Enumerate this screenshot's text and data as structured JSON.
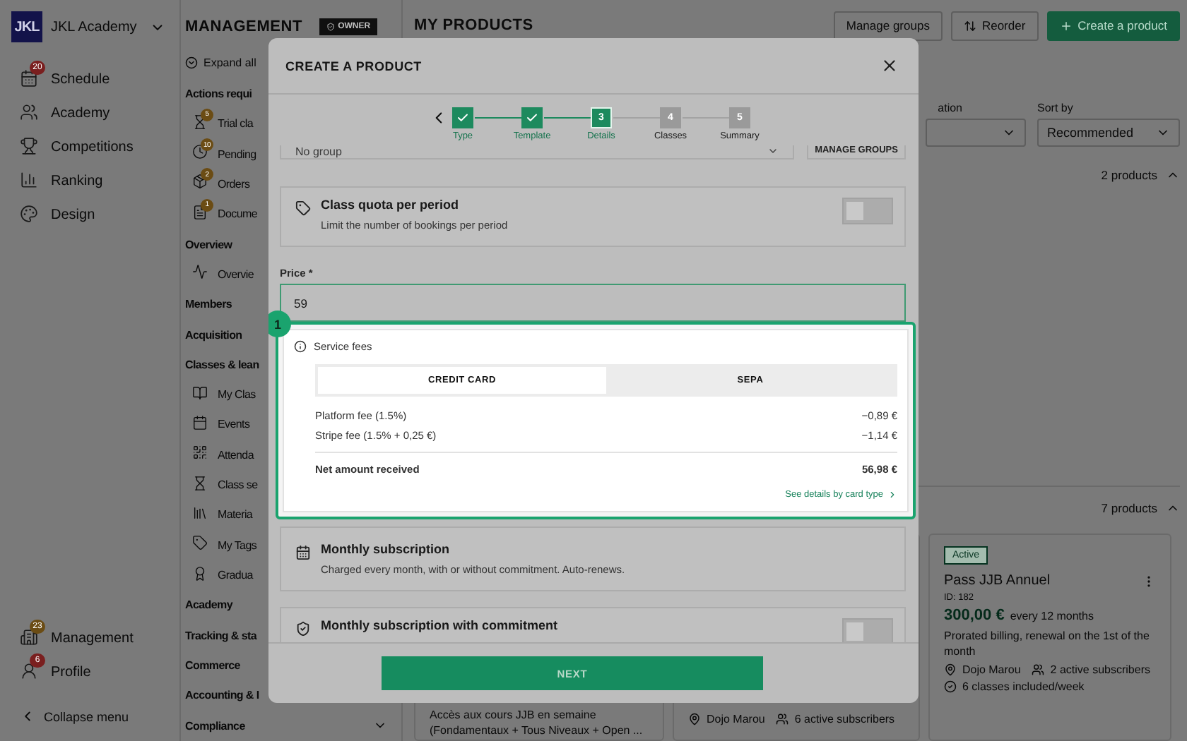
{
  "sidebar": {
    "logo": "JKL",
    "name": "JKL Academy",
    "items": [
      {
        "label": "Schedule",
        "badge": {
          "text": "20",
          "color": "#7a1f1f"
        }
      },
      {
        "label": "Academy"
      },
      {
        "label": "Competitions"
      },
      {
        "label": "Ranking"
      },
      {
        "label": "Design"
      }
    ],
    "bottom_items": [
      {
        "label": "Management",
        "badge": {
          "text": "23",
          "color": "#6b4c14"
        }
      },
      {
        "label": "Profile",
        "badge": {
          "text": "6",
          "color": "#7a1f1f"
        }
      }
    ],
    "collapse": "Collapse menu"
  },
  "management_nav": {
    "title": "MANAGEMENT",
    "role": "OWNER",
    "expand_all": "Expand all",
    "entries": [
      {
        "kind": "section",
        "label": "Actions requi"
      },
      {
        "kind": "item",
        "label": "Trial cla",
        "badge": "5"
      },
      {
        "kind": "item",
        "label": "Pending",
        "badge": "10"
      },
      {
        "kind": "item",
        "label": "Orders",
        "badge": "2"
      },
      {
        "kind": "item",
        "label": "Docume",
        "badge": "1"
      },
      {
        "kind": "section",
        "label": "Overview"
      },
      {
        "kind": "item",
        "label": "Overvie"
      },
      {
        "kind": "section",
        "label": "Members"
      },
      {
        "kind": "section",
        "label": "Acquisition"
      },
      {
        "kind": "section",
        "label": "Classes & lean"
      },
      {
        "kind": "item",
        "label": "My Clas"
      },
      {
        "kind": "item",
        "label": "Events"
      },
      {
        "kind": "item",
        "label": "Attenda"
      },
      {
        "kind": "item",
        "label": "Class se"
      },
      {
        "kind": "item",
        "label": "Materia"
      },
      {
        "kind": "item",
        "label": "My Tags"
      },
      {
        "kind": "item",
        "label": "Gradua"
      },
      {
        "kind": "section",
        "label": "Academy"
      },
      {
        "kind": "section",
        "label": "Tracking & sta"
      },
      {
        "kind": "section",
        "label": "Commerce"
      },
      {
        "kind": "section",
        "label": "Accounting & I"
      },
      {
        "kind": "section",
        "label": "Compliance",
        "expanded": false
      }
    ]
  },
  "main": {
    "title": "MY PRODUCTS",
    "actions": [
      {
        "kind": "outline",
        "label": "Manage groups"
      },
      {
        "kind": "outline",
        "label": "Reorder"
      },
      {
        "kind": "primary",
        "label": "Create a product"
      }
    ],
    "filters": [
      {
        "label": "ation"
      },
      {
        "label": "Sort by",
        "value": "Recommended"
      }
    ],
    "groups": [
      {
        "count": "2 products",
        "expanded": true
      },
      {
        "count": "7 products",
        "expanded": true
      }
    ],
    "cards": [
      {
        "description": "Accès aux cours JJB en semaine (Fondamentaux + Tous Niveaux + Open ..."
      },
      {
        "location": "Dojo Marou",
        "subscribers": "6 active subscribers"
      },
      {
        "status": "Active",
        "name": "Pass JJB Annuel",
        "id": "ID: 182",
        "price": "300,00 €",
        "period": "every 12 months",
        "note": "Prorated billing, renewal on the 1st of the month",
        "location": "Dojo Marou",
        "subscribers": "2 active subscribers",
        "classes": "6 classes included/week"
      }
    ]
  },
  "modal": {
    "title": "CREATE A PRODUCT",
    "steps": [
      {
        "label": "Type",
        "completed": true,
        "selected": false
      },
      {
        "label": "Template",
        "completed": true,
        "selected": false
      },
      {
        "label": "Details",
        "completed": false,
        "selected": true,
        "number": "3"
      },
      {
        "label": "Classes",
        "completed": false,
        "selected": false,
        "number": "4"
      },
      {
        "label": "Summary",
        "completed": false,
        "selected": false,
        "number": "5"
      }
    ],
    "group_select": {
      "value": "No group",
      "button": "MANAGE GROUPS"
    },
    "quota": {
      "title": "Class quota per period",
      "subtitle": "Limit the number of bookings per period",
      "on": false
    },
    "price": {
      "label": "Price *",
      "value": "59"
    },
    "service_fees": {
      "marker": "1",
      "title": "Service fees",
      "tabs": [
        {
          "label": "CREDIT CARD",
          "selected": true
        },
        {
          "label": "SEPA",
          "selected": false
        }
      ],
      "rows": [
        {
          "label": "Platform fee (1.5%)",
          "amount": "−0,89 €"
        },
        {
          "label": "Stripe fee (1.5% + 0,25 €)",
          "amount": "−1,14 €"
        }
      ],
      "total": {
        "label": "Net amount received",
        "amount": "56,98 €"
      },
      "link": "See details by card type"
    },
    "billing_options": [
      {
        "title": "Monthly subscription",
        "subtitle": "Charged every month, with or without commitment. Auto-renews."
      },
      {
        "title": "Monthly subscription with commitment",
        "on": false
      }
    ],
    "next": "NEXT"
  }
}
